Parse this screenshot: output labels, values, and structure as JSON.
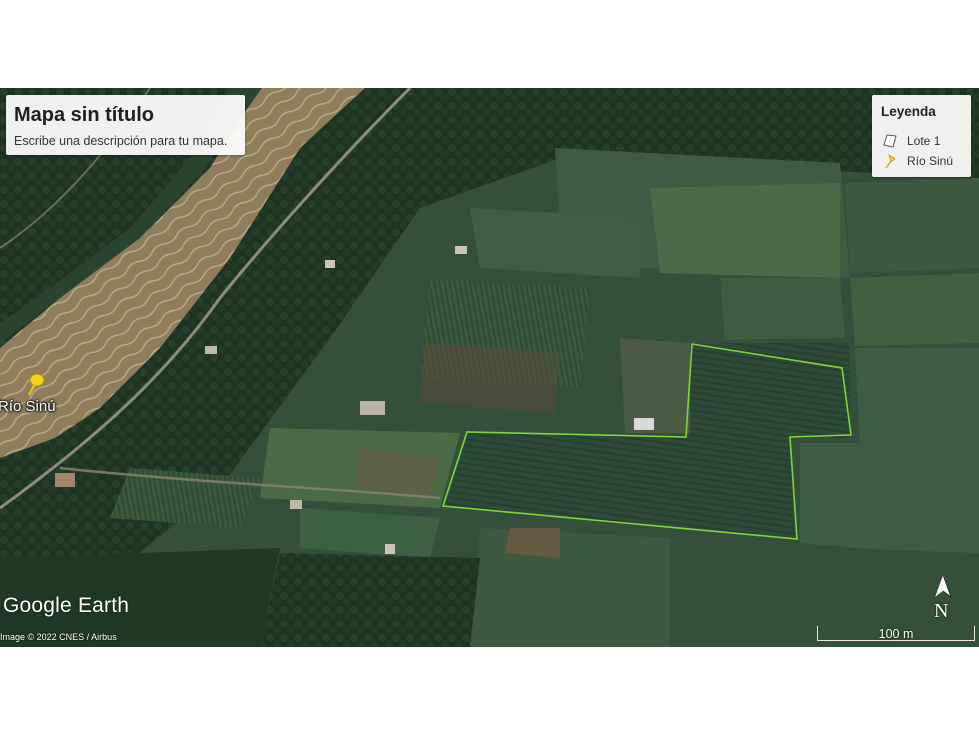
{
  "map": {
    "title": "Mapa sin título",
    "description": "Escribe una descripción para tu mapa.",
    "legend": {
      "title": "Leyenda",
      "items": [
        {
          "label": "Lote 1",
          "icon": "polygon-icon"
        },
        {
          "label": "Río Sinú",
          "icon": "yellow-pushpin-icon"
        }
      ]
    },
    "placemark": {
      "label": "Río Sinú",
      "icon": "yellow-pushpin-icon"
    },
    "branding": "Google Earth",
    "imagery_credit": "Image © 2022 CNES / Airbus",
    "scale_label": "100 m",
    "compass_label": "N",
    "colors": {
      "polygon_outline": "#7cd639",
      "pushpin": "#f2d21b",
      "river": "#8c7a5a"
    }
  }
}
